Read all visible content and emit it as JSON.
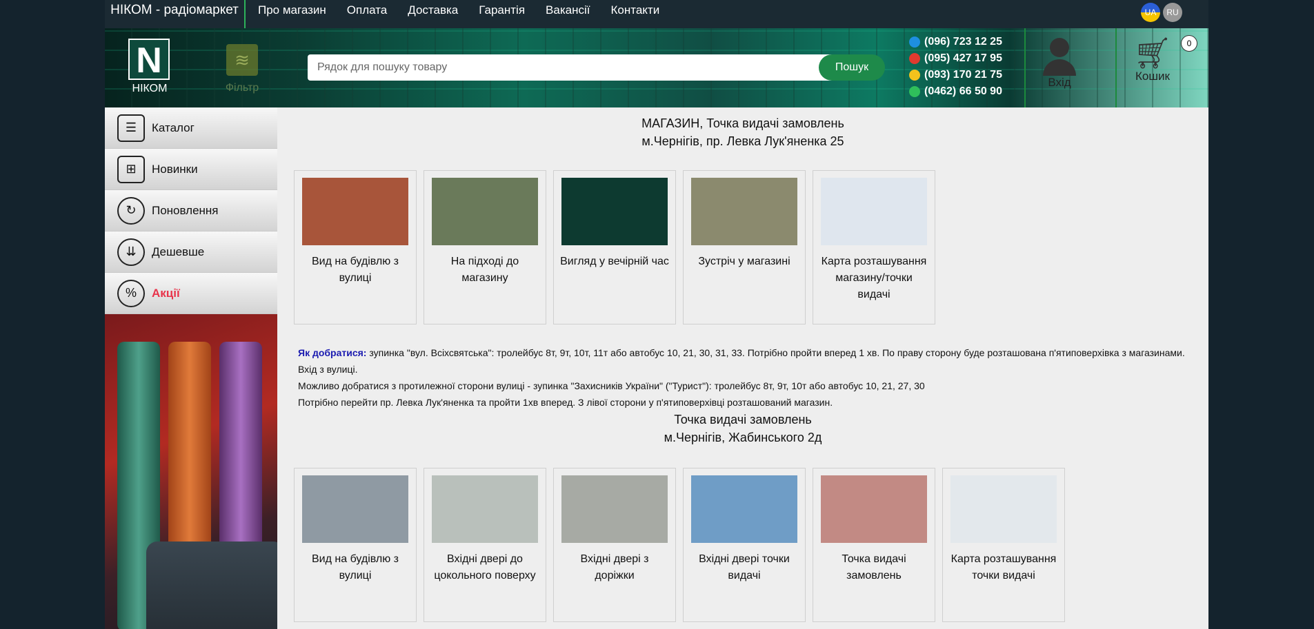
{
  "nav": {
    "brand": "НІКОМ - радіомаркет",
    "links": [
      "Про магазин",
      "Оплата",
      "Доставка",
      "Гарантія",
      "Вакансії",
      "Контакти"
    ],
    "lang_ua": "UA",
    "lang_ru": "RU"
  },
  "header": {
    "logo_letter": "N",
    "logo_text": "НІКОМ",
    "filter_label": "Фільтр",
    "search_placeholder": "Рядок для пошуку товару",
    "search_button": "Пошук",
    "phones": [
      {
        "number": "(096) 723 12 25",
        "color": "#1e8fe0"
      },
      {
        "number": "(095) 427 17 95",
        "color": "#e03a2f"
      },
      {
        "number": "(093) 170 21 75",
        "color": "#f2c21c"
      },
      {
        "number": "(0462) 66 50 90",
        "color": "#2fbf5b"
      }
    ],
    "login_label": "Вхід",
    "cart_label": "Кошик",
    "cart_count": "0"
  },
  "sidebar": {
    "items": [
      {
        "label": "Каталог",
        "icon": "catalog-icon"
      },
      {
        "label": "Новинки",
        "icon": "chip-plus-icon"
      },
      {
        "label": "Поновлення",
        "icon": "refresh-icon"
      },
      {
        "label": "Дешевше",
        "icon": "cheaper-icon"
      },
      {
        "label": "Акції",
        "icon": "percent-gear-icon"
      }
    ]
  },
  "store1": {
    "title_line1": "МАГАЗИН, Точка видачі замовлень",
    "title_line2": "м.Чернігів, пр. Левка Лук'яненка 25",
    "photos": [
      {
        "caption": "Вид на будівлю з вулиці",
        "color": "#a8553a"
      },
      {
        "caption": "На підході до магазину",
        "color": "#6a7a5a"
      },
      {
        "caption": "Вигляд у вечірній час",
        "color": "#0d3a30"
      },
      {
        "caption": "Зустріч у магазині",
        "color": "#8b8a6e"
      },
      {
        "caption": "Карта розташування магазину/точки видачі",
        "color": "#dfe6ee"
      }
    ],
    "directions_label": "Як добратися:",
    "directions_text": " зупинка \"вул. Всіхсвятська\": тролейбус 8т, 9т, 10т, 11т або автобус 10, 21, 30, 31, 33. Потрібно пройти вперед 1 хв. По праву сторону буде розташована п'ятиповерхівка з магазинами.",
    "line2": "Вхід з вулиці.",
    "line3": "Можливо добратися з протилежної сторони вулиці - зупинка \"Захисників України\" (\"Турист\"): тролейбус 8т, 9т, 10т або автобус 10, 21, 27, 30",
    "line4": "Потрібно перейти пр. Левка Лук'яненка та пройти 1хв вперед. З лівої сторони у п'ятиповерхівці розташований магазин."
  },
  "store2": {
    "title_line1": "Точка видачі замовлень",
    "title_line2": "м.Чернігів, Жабинського 2д",
    "photos": [
      {
        "caption": "Вид на будівлю з вулиці",
        "color": "#8f9aa3"
      },
      {
        "caption": "Вхідні двері до цокольного поверху",
        "color": "#b9c0bb"
      },
      {
        "caption": "Вхідні двері з доріжки",
        "color": "#a7aaa4"
      },
      {
        "caption": "Вхідні двері точки видачі",
        "color": "#6f9dc6"
      },
      {
        "caption": "Точка видачі замовлень",
        "color": "#c28a84"
      },
      {
        "caption": "Карта розташування точки видачі",
        "color": "#e3e8ec"
      }
    ]
  }
}
